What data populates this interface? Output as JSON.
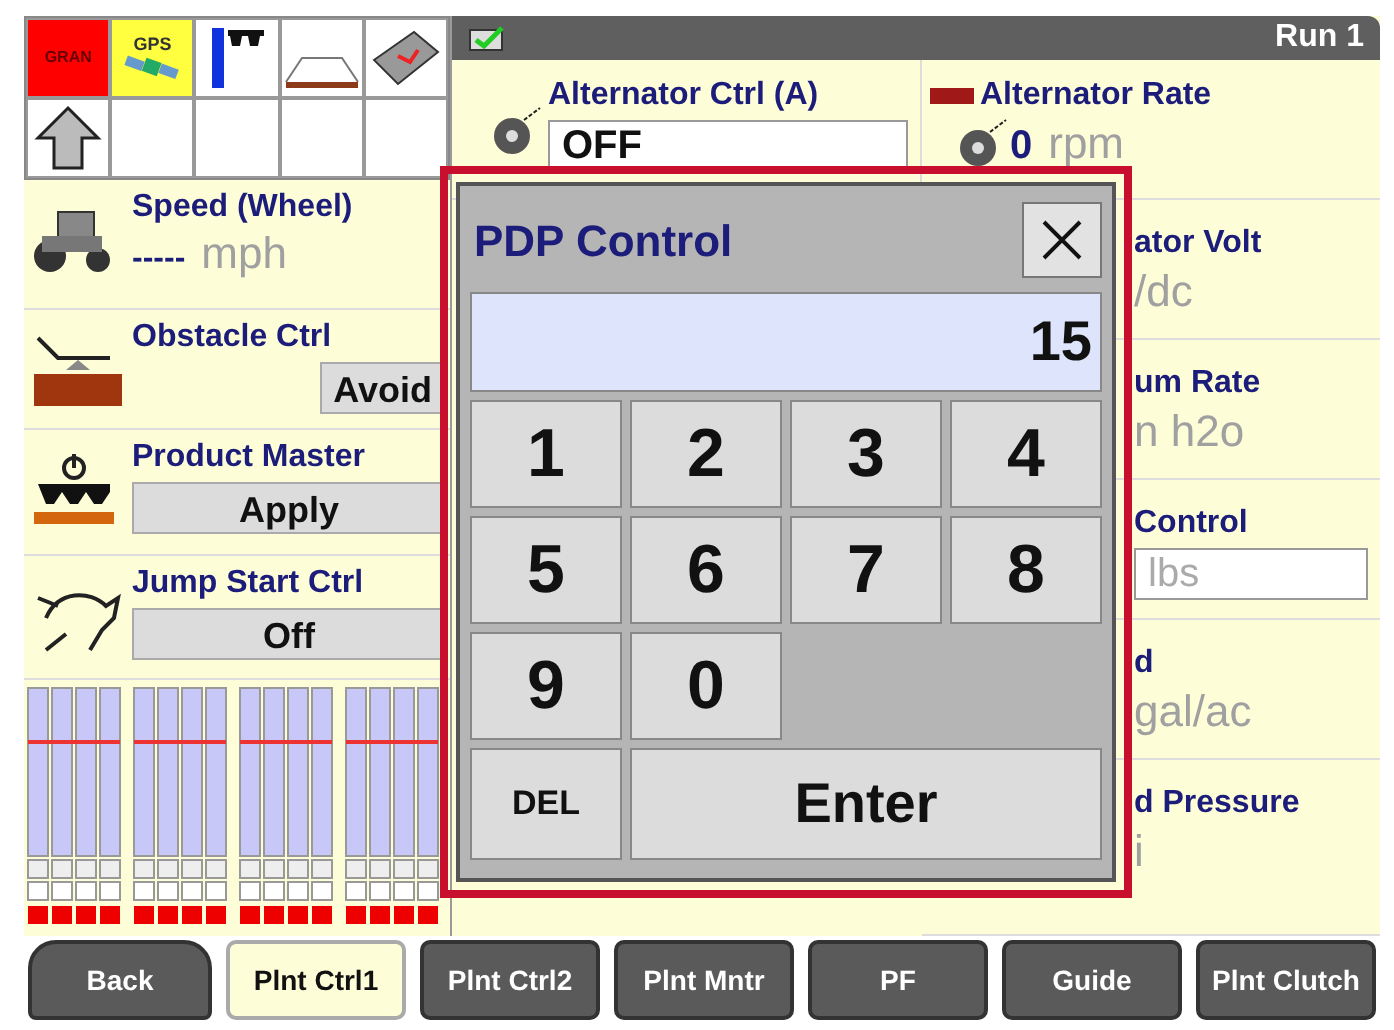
{
  "status": {
    "gran_label": "GRAN",
    "gps_label": "GPS"
  },
  "left_cards": [
    {
      "kind": "reading",
      "label": "Speed (Wheel)",
      "value": "-----",
      "unit": "mph"
    },
    {
      "kind": "button",
      "label": "Obstacle Ctrl",
      "button": "Avoid"
    },
    {
      "kind": "button",
      "label": "Product Master",
      "button": "Apply"
    },
    {
      "kind": "button",
      "label": "Jump Start Ctrl",
      "button": "Off"
    }
  ],
  "header": {
    "title": "Run 1"
  },
  "cells": [
    {
      "kind": "field",
      "label": "Alternator Ctrl (A)",
      "value": "OFF"
    },
    {
      "kind": "reading",
      "label": "Alternator Rate",
      "value": "0",
      "unit": "rpm"
    },
    {
      "kind": "reading",
      "label": "ator Volt",
      "unit": "/dc"
    },
    {
      "kind": "reading",
      "label": "um Rate",
      "unit": "n h2o"
    },
    {
      "kind": "field",
      "label": "Control",
      "placeholder": "lbs"
    },
    {
      "kind": "reading",
      "label": "d",
      "unit": "gal/ac"
    },
    {
      "kind": "reading",
      "label": "d Pressure",
      "unit": "i"
    }
  ],
  "dialog": {
    "title": "PDP Control",
    "display": "15",
    "keys": [
      "1",
      "2",
      "3",
      "4",
      "5",
      "6",
      "7",
      "8",
      "9",
      "0"
    ],
    "delete": "DEL",
    "enter": "Enter"
  },
  "tabs": [
    {
      "label": "Back",
      "kind": "back",
      "selected": false
    },
    {
      "label": "Plnt Ctrl1",
      "kind": "tab",
      "selected": true
    },
    {
      "label": "Plnt Ctrl2",
      "kind": "tab",
      "selected": false
    },
    {
      "label": "Plnt Mntr",
      "kind": "tab",
      "selected": false
    },
    {
      "label": "PF",
      "kind": "tab",
      "selected": false
    },
    {
      "label": "Guide",
      "kind": "tab",
      "selected": false
    },
    {
      "label": "Plnt Clutch",
      "kind": "tab",
      "selected": false
    }
  ]
}
